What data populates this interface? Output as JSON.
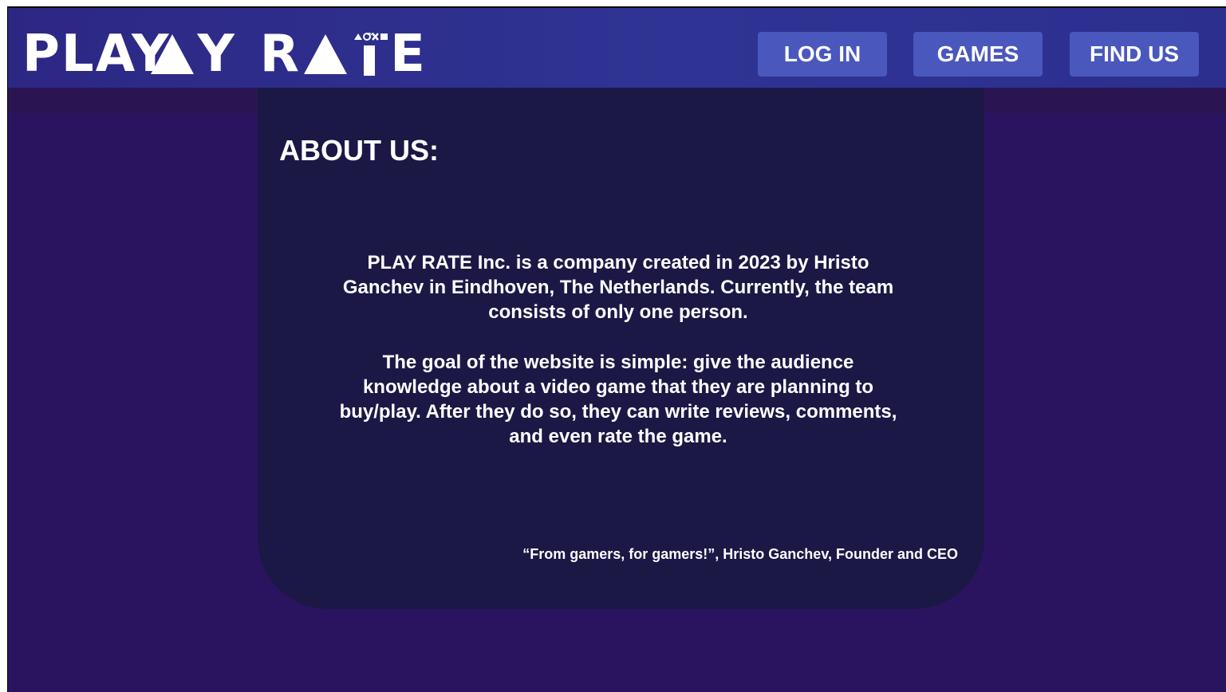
{
  "header": {
    "logo_text_left": "PLAY",
    "logo_text_right": "R",
    "logo_text_end": "E",
    "logo_trademark": "™",
    "nav": {
      "login_label": "LOG IN",
      "games_label": "GAMES",
      "findus_label": "FIND US"
    }
  },
  "about": {
    "title": "ABOUT US:",
    "paragraph_1": "PLAY RATE Inc. is a company created in 2023 by Hristo Ganchev in Eindhoven, The Netherlands. Currently, the team consists of only one person.",
    "paragraph_2": "The goal of the website is simple: give the audience knowledge about a video game that they are planning to buy/play.  After they do so, they can write reviews, comments, and even rate the game.",
    "quote": "“From gamers, for gamers!”, Hristo Ganchev, Founder and CEO"
  },
  "colors": {
    "page_background": "#2a1460",
    "header_background": "#2f3494",
    "card_background": "#1b1846",
    "nav_button": "#4a57bd",
    "text": "#ffffff"
  },
  "icons": {
    "logo_triangle": "triangle-icon",
    "logo_playstation_symbols": "triangle-circle-cross-square-icon"
  }
}
